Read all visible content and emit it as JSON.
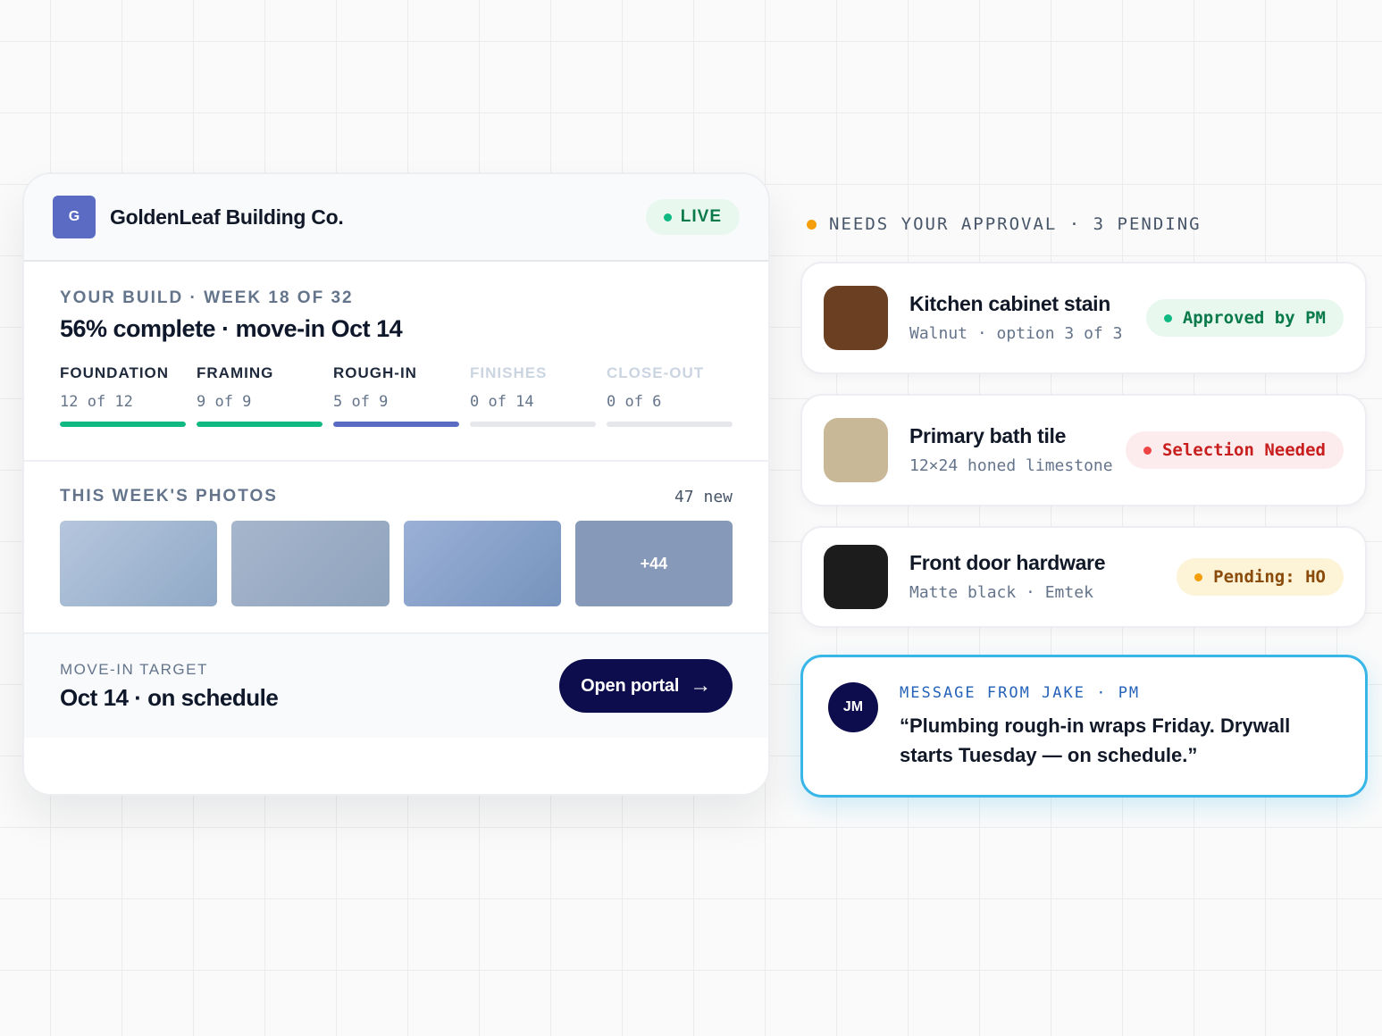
{
  "company": {
    "logo_letter": "G",
    "name": "GoldenLeaf Building Co.",
    "status": "LIVE"
  },
  "build": {
    "kicker": "YOUR BUILD · WEEK 18 OF 32",
    "headline": "56% complete · move-in Oct 14",
    "phases": [
      {
        "name": "FOUNDATION",
        "count": "12 of 12",
        "progress": 1.0,
        "color": "#10b981"
      },
      {
        "name": "FRAMING",
        "count": "9 of 9",
        "progress": 1.0,
        "color": "#10b981"
      },
      {
        "name": "ROUGH-IN",
        "count": "5 of 9",
        "progress": 1.0,
        "color": "#5b6bc4"
      },
      {
        "name": "FINISHES",
        "count": "0 of 14",
        "progress": 0,
        "color": "#e5e7eb"
      },
      {
        "name": "CLOSE-OUT",
        "count": "0 of 6",
        "progress": 0,
        "color": "#e5e7eb"
      }
    ]
  },
  "photos": {
    "title": "THIS WEEK'S PHOTOS",
    "new_count": "47 new",
    "more_label": "+44"
  },
  "footer": {
    "label": "MOVE-IN TARGET",
    "value": "Oct 14 · on schedule",
    "button_label": "Open portal",
    "button_arrow": "→"
  },
  "approvals": {
    "header": "NEEDS YOUR APPROVAL · 3 PENDING",
    "items": [
      {
        "title": "Kitchen cabinet stain",
        "subtitle": "Walnut · option 3 of 3",
        "swatch": "#6b3f22",
        "badge": "Approved by PM",
        "badge_bg": "#e8f8ef",
        "badge_fg": "#0b7a4b",
        "dot": "#10b981"
      },
      {
        "title": "Primary bath tile",
        "subtitle": "12×24 honed limestone",
        "swatch": "#c8b898",
        "badge": "Selection Needed",
        "badge_bg": "#fdecee",
        "badge_fg": "#c81e1e",
        "dot": "#ef4444"
      },
      {
        "title": "Front door hardware",
        "subtitle": "Matte black · Emtek",
        "swatch": "#1c1c1c",
        "badge": "Pending: HO",
        "badge_bg": "#fdf3d7",
        "badge_fg": "#8a4b0a",
        "dot": "#f59e0b"
      }
    ]
  },
  "message": {
    "initials": "JM",
    "label": "MESSAGE FROM JAKE · PM",
    "text": "“Plumbing rough-in wraps Friday. Drywall starts Tuesday — on schedule.”"
  }
}
